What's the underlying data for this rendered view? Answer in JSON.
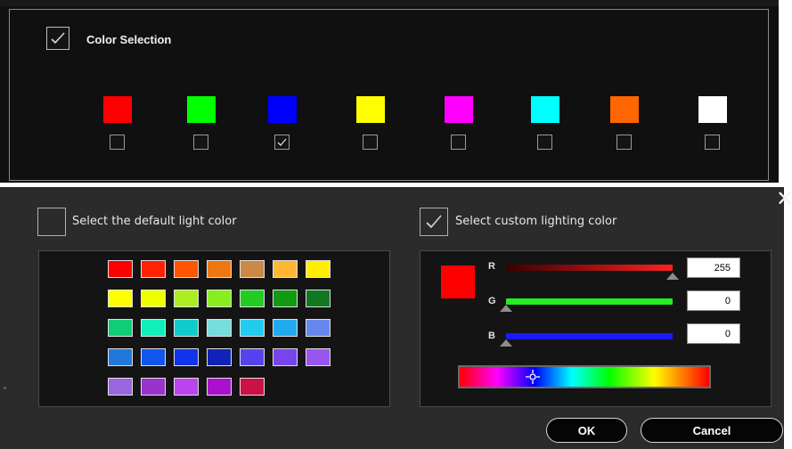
{
  "top_panel": {
    "title": "Color Selection",
    "master_checked": true,
    "swatches": [
      {
        "color": "#ff0000",
        "checked": false
      },
      {
        "color": "#00ff00",
        "checked": false
      },
      {
        "color": "#0000ff",
        "checked": true
      },
      {
        "color": "#ffff00",
        "checked": false
      },
      {
        "color": "#ff00ff",
        "checked": false
      },
      {
        "color": "#00ffff",
        "checked": false
      },
      {
        "color": "#ff6600",
        "checked": false
      },
      {
        "color": "#ffffff",
        "checked": false
      }
    ]
  },
  "default_option": {
    "label": "Select the default light color",
    "checked": false
  },
  "custom_option": {
    "label": "Select custom lighting color",
    "checked": true
  },
  "palette": [
    [
      "#ff0000",
      "#ff2200",
      "#ff5500",
      "#ee7711",
      "#cc8844",
      "#ffb833",
      "#ffee00"
    ],
    [
      "#ffff00",
      "#eeff00",
      "#aaee22",
      "#88ee22",
      "#22cc22",
      "#119911",
      "#117722"
    ],
    [
      "#11cc77",
      "#11eebb",
      "#11cccc",
      "#77dddd",
      "#22ccee",
      "#22aaee",
      "#6688ee"
    ],
    [
      "#2277dd",
      "#1155ee",
      "#1133ee",
      "#1122bb",
      "#5544ee",
      "#7744ee",
      "#9955ee"
    ],
    [
      "#9966dd",
      "#9933cc",
      "#bb44ee",
      "#aa11cc",
      "#cc1144"
    ]
  ],
  "rgb": {
    "r_label": "R",
    "g_label": "G",
    "b_label": "B",
    "r": "255",
    "g": "0",
    "b": "0",
    "r_level": 1.0,
    "g_level": 0.0,
    "b_level": 0.0,
    "preview_color": "#ff0000"
  },
  "buttons": {
    "ok": "OK",
    "cancel": "Cancel"
  }
}
